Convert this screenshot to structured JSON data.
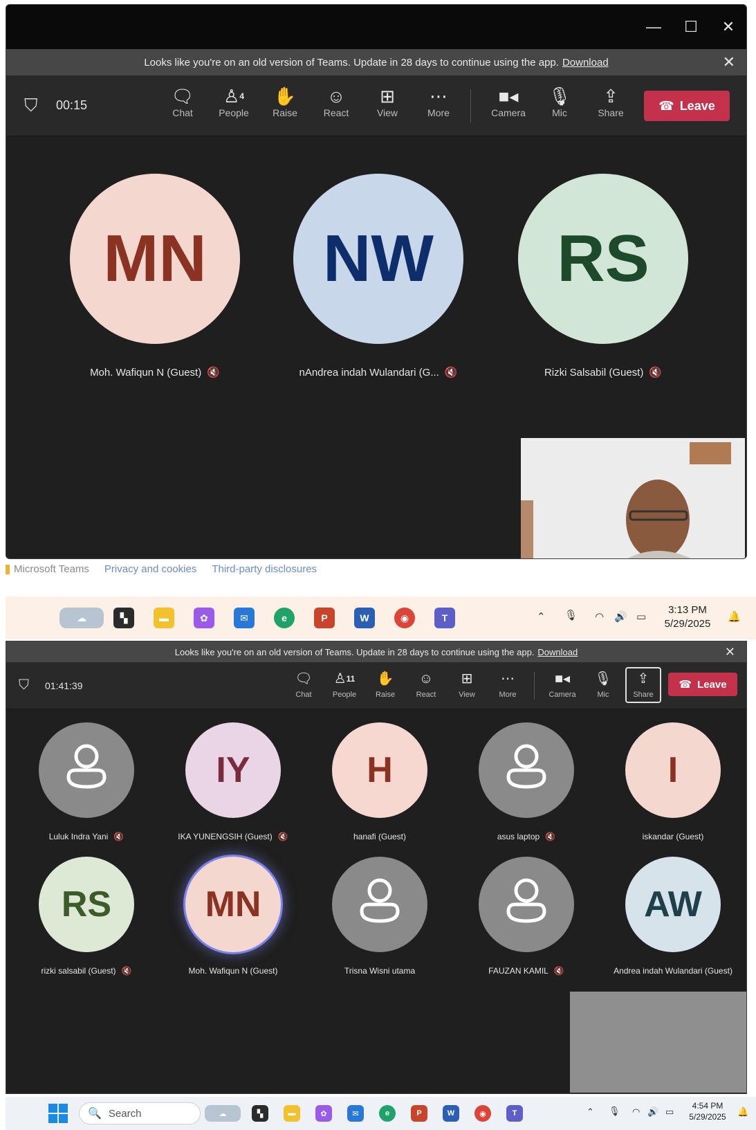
{
  "top": {
    "window_controls": [
      "—",
      "☐",
      "✕"
    ],
    "banner": {
      "text": "Looks like you're on an old version of Teams. Update in 28 days to continue using the app.",
      "link": "Download"
    },
    "timer": "00:15",
    "toolbar": {
      "chat": "Chat",
      "people": "People",
      "people_count": "4",
      "raise": "Raise",
      "react": "React",
      "view": "View",
      "more": "More",
      "camera": "Camera",
      "mic": "Mic",
      "share": "Share",
      "leave": "Leave"
    },
    "participants": [
      {
        "initials": "MN",
        "name": "Moh. Wafiqun N (Guest)",
        "bg": "#f4d7cf",
        "fg": "#8a3322"
      },
      {
        "initials": "NW",
        "name": "nAndrea indah Wulandari (G...",
        "bg": "#c9d7ea",
        "fg": "#0d2d6b"
      },
      {
        "initials": "RS",
        "name": "Rizki Salsabil (Guest)",
        "bg": "#d1e6d6",
        "fg": "#1e4a2c"
      }
    ],
    "footer": {
      "brand": "Microsoft Teams",
      "privacy": "Privacy and cookies",
      "third_party": "Third-party disclosures"
    },
    "clock": {
      "time": "3:13 PM",
      "date": "5/29/2025"
    }
  },
  "bottom": {
    "banner": {
      "text": "Looks like you're on an old version of Teams. Update in 28 days to continue using the app.",
      "link": "Download"
    },
    "timer": "01:41:39",
    "toolbar": {
      "chat": "Chat",
      "people": "People",
      "people_count": "11",
      "raise": "Raise",
      "react": "React",
      "view": "View",
      "more": "More",
      "camera": "Camera",
      "mic": "Mic",
      "share": "Share",
      "leave": "Leave"
    },
    "participants": [
      {
        "initials": "",
        "name": "Luluk Indra Yani",
        "muted": true,
        "bg": "#8a8a8a",
        "fg": "#ffffff"
      },
      {
        "initials": "IY",
        "name": "IKA YUNENGSIH (Guest)",
        "muted": true,
        "bg": "#ead5e6",
        "fg": "#7a2c3f"
      },
      {
        "initials": "H",
        "name": "hanafi (Guest)",
        "muted": false,
        "bg": "#f7d8d0",
        "fg": "#8a3322"
      },
      {
        "initials": "",
        "name": "asus laptop",
        "muted": true,
        "bg": "#8a8a8a",
        "fg": "#ffffff"
      },
      {
        "initials": "I",
        "name": "iskandar (Guest)",
        "muted": false,
        "bg": "#f4d7cf",
        "fg": "#8a3322"
      },
      {
        "initials": "RS",
        "name": "rizki salsabil (Guest)",
        "muted": true,
        "bg": "#dde9d4",
        "fg": "#3d5a2a"
      },
      {
        "initials": "MN",
        "name": "Moh. Wafiqun N (Guest)",
        "muted": false,
        "bg": "#f4d7cf",
        "fg": "#8a3322",
        "speaking": true
      },
      {
        "initials": "",
        "name": "Trisna Wisni utama",
        "muted": false,
        "bg": "#8a8a8a",
        "fg": "#ffffff"
      },
      {
        "initials": "",
        "name": "FAUZAN KAMIL",
        "muted": true,
        "bg": "#8a8a8a",
        "fg": "#ffffff"
      },
      {
        "initials": "AW",
        "name": "Andrea indah Wulandari (Guest)",
        "muted": false,
        "bg": "#d6e3ea",
        "fg": "#1f3f4a"
      }
    ],
    "search_placeholder": "Search",
    "clock": {
      "time": "4:54 PM",
      "date": "5/29/2025"
    }
  },
  "icons": {
    "shield": "◯",
    "chat": "💬",
    "people": "👥",
    "raise": "✋",
    "react": "☺",
    "view": "⊞",
    "more": "⋯",
    "camera": "■",
    "mic": "🎙",
    "share": "⇧",
    "phone": "☎",
    "mute": "🔇",
    "person": "👤",
    "close": "✕"
  }
}
